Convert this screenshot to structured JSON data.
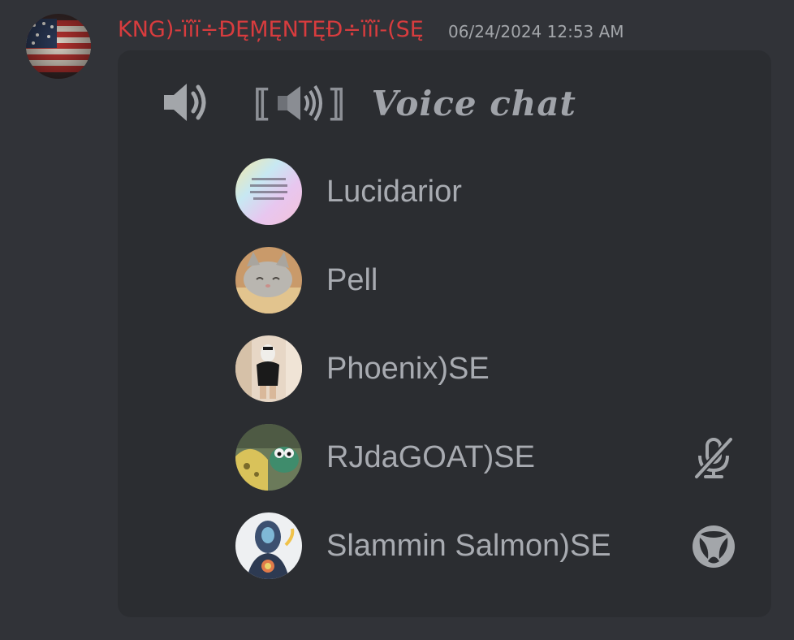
{
  "message": {
    "author": "KNG)-ïîï÷ĐĘM̦ĘNTĘĐ÷ïîï-(SĘ",
    "timestamp": "06/24/2024 12:53 AM",
    "author_color": "#d83c3e"
  },
  "embed": {
    "channel_icon": "speaker-icon",
    "channel_title_bracket_left": "⟦",
    "channel_title_bracket_right": "⟧",
    "channel_name": "Voice chat",
    "members": [
      {
        "name": "Lucidarior",
        "avatar_text": "feeling cute, might smash the prodest bloody zero ink",
        "status_icon": ""
      },
      {
        "name": "Pell",
        "status_icon": ""
      },
      {
        "name": "Phoenix)SE",
        "status_icon": ""
      },
      {
        "name": "RJdaGOAT)SE",
        "status_icon": "muted-mic-icon"
      },
      {
        "name": "Slammin Salmon)SE",
        "status_icon": "xbox-icon"
      }
    ]
  },
  "colors": {
    "background": "#313338",
    "embed_background": "#2b2d31",
    "text_muted": "#a8abb1"
  }
}
